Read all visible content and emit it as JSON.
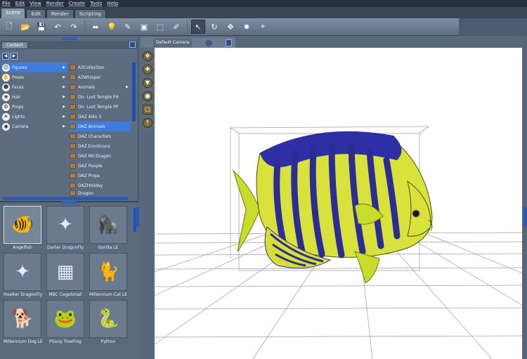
{
  "menu": [
    "File",
    "Edit",
    "View",
    "Render",
    "Create",
    "Tools",
    "Help"
  ],
  "tabs": [
    "Scene",
    "Edit",
    "Render",
    "Scripting"
  ],
  "toolbar_icons": [
    "new-icon",
    "open-icon",
    "save-icon",
    "undo-icon",
    "redo-icon",
    "node-icon",
    "light-icon",
    "pose-icon",
    "cube-icon",
    "select-icon",
    "pen-icon",
    "pointer-icon",
    "rotate-icon",
    "move-icon",
    "universal-icon",
    "camera-icon"
  ],
  "content": {
    "tab_label": "Content",
    "categories": [
      {
        "label": "Figures",
        "icon": "☺"
      },
      {
        "label": "Poses",
        "icon": "✋"
      },
      {
        "label": "Faces",
        "icon": "☻"
      },
      {
        "label": "Hair",
        "icon": "❀"
      },
      {
        "label": "Props",
        "icon": "⚙"
      },
      {
        "label": "Lights",
        "icon": "☀"
      },
      {
        "label": "Camera",
        "icon": "◉"
      }
    ],
    "folders": [
      "A3Collection",
      "A3Whisper",
      "Animals",
      "On- Lost Temple P4",
      "On- Lost Temple PP",
      "DAZ Aiko 3",
      "DAZ Animals",
      "DAZ Characters",
      "DAZ Emoticons",
      "DAZ Mil Dragon",
      "DAZ People",
      "DAZ Props",
      "DAZHoliday",
      "Dragon"
    ]
  },
  "thumbnails": [
    {
      "label": "Angelfish",
      "icon": "🐠"
    },
    {
      "label": "Darter DragonFly",
      "icon": "✦"
    },
    {
      "label": "Gorilla LE",
      "icon": "🦍"
    },
    {
      "label": "Hawker DragonFly",
      "icon": "✦"
    },
    {
      "label": "MBC CageSmall",
      "icon": "▦"
    },
    {
      "label": "Millennium Cat LE",
      "icon": "🐈"
    },
    {
      "label": "Millennium Dog LE",
      "icon": "🐕"
    },
    {
      "label": "PSong TreeFrog",
      "icon": "🐸"
    },
    {
      "label": "Python",
      "icon": "🐍"
    }
  ],
  "viewport": {
    "camera_label": "Default Camera"
  }
}
